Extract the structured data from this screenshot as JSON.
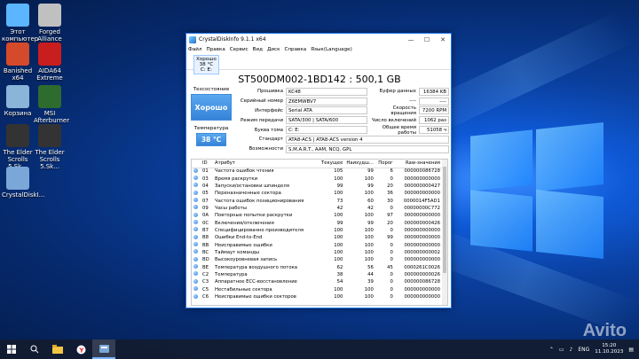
{
  "desktop": {
    "icons": [
      {
        "label": "Этот компьютер",
        "icon": "computer-icon",
        "color": "#5bb5ff"
      },
      {
        "label": "Forged Alliance",
        "icon": "forged-alliance-icon",
        "color": "#c0c0c0"
      },
      {
        "label": "Banished x64",
        "icon": "banished-icon",
        "color": "#d44a2a"
      },
      {
        "label": "AIDA64 Extreme",
        "icon": "aida64-icon",
        "color": "#c81e1e"
      },
      {
        "label": "Корзина",
        "icon": "recycle-bin-icon",
        "color": "#8ab4d8"
      },
      {
        "label": "MSI Afterburner",
        "icon": "msi-afterburner-icon",
        "color": "#2e6b2e"
      },
      {
        "label": "The Elder Scrolls 5.Sk...",
        "icon": "skyrim-icon",
        "color": "#333"
      },
      {
        "label": "The Elder Scrolls 5.Sk...",
        "icon": "skyrim-icon",
        "color": "#333"
      },
      {
        "label": "CrystalDiskI...",
        "icon": "crystaldiskinfo-icon",
        "color": "#7aa7d8"
      }
    ]
  },
  "window": {
    "title": "CrystalDiskInfo 9.1.1 x64",
    "controls": [
      "—",
      "☐",
      "✕"
    ],
    "menu": [
      "Файл",
      "Правка",
      "Сервис",
      "Вид",
      "Диск",
      "Справка",
      "Язык(Language)"
    ],
    "drive_tab": {
      "status": "Хорошо",
      "temp": "38 °C",
      "letter": "C: E:"
    }
  },
  "disk": {
    "model": "ST500DM002-1BD142 : 500,1 GB",
    "tech_status_label": "Техсостояние",
    "tech_status": "Хорошо",
    "temp_label": "Температура",
    "temp": "38 °C",
    "firmware_label": "Прошивка",
    "firmware": "KC48",
    "serial_label": "Серийный номер",
    "serial": "Z6EMWBV7",
    "interface_label": "Интерфейс",
    "interface": "Serial ATA",
    "transfer_label": "Режим передачи",
    "transfer": "SATA/300 | SATA/600",
    "letter_label": "Буква тома",
    "letter": "C: E:",
    "standard_label": "Стандарт",
    "standard": "ATA8-ACS | ATA8-ACS version 4",
    "features_label": "Возможности",
    "features": "S.M.A.R.T., AAM, NCQ, GPL",
    "buffer_label": "Буфер данных",
    "buffer": "16384 KB",
    "blank1": "----",
    "blank2": "----",
    "rpm_label": "Скорость вращения",
    "rpm": "7200 RPM",
    "power_count_label": "Число включений",
    "power_count": "1062 раз",
    "power_hours_label": "Общее время работы",
    "power_hours": "51058 ч"
  },
  "smart": {
    "headers": [
      "ID",
      "Атрибут",
      "Текущее",
      "Наихудш...",
      "Порог",
      "Raw-значения"
    ],
    "rows": [
      [
        "01",
        "Частота ошибок чтения",
        "105",
        "99",
        "6",
        "000000086728"
      ],
      [
        "03",
        "Время раскрутки",
        "100",
        "100",
        "0",
        "000000000000"
      ],
      [
        "04",
        "Запуски/остановки шпинделя",
        "99",
        "99",
        "20",
        "000000000427"
      ],
      [
        "05",
        "Переназначенные сектора",
        "100",
        "100",
        "36",
        "000000000000"
      ],
      [
        "07",
        "Частота ошибок позиционирования",
        "73",
        "60",
        "30",
        "0000014F5AD1"
      ],
      [
        "09",
        "Часы работы",
        "42",
        "42",
        "0",
        "00000000C772"
      ],
      [
        "0A",
        "Повторные попытки раскрутки",
        "100",
        "100",
        "97",
        "000000000000"
      ],
      [
        "0C",
        "Включения/отключения",
        "99",
        "99",
        "20",
        "000000000426"
      ],
      [
        "B7",
        "Специфицированно производителя",
        "100",
        "100",
        "0",
        "000000000000"
      ],
      [
        "B8",
        "Ошибки End-to-End",
        "100",
        "100",
        "99",
        "000000000000"
      ],
      [
        "BB",
        "Неисправимые ошибки",
        "100",
        "100",
        "0",
        "000000000000"
      ],
      [
        "BC",
        "Таймаут команды",
        "100",
        "100",
        "0",
        "000000000002"
      ],
      [
        "BD",
        "Высокоуровневая запись",
        "100",
        "100",
        "0",
        "000000000000"
      ],
      [
        "BE",
        "Температура воздушного потока",
        "62",
        "56",
        "45",
        "0000261C0026"
      ],
      [
        "C2",
        "Температура",
        "38",
        "44",
        "0",
        "000000000026"
      ],
      [
        "C3",
        "Аппаратное ECC-восстановление",
        "54",
        "39",
        "0",
        "000000086728"
      ],
      [
        "C5",
        "Нестабильные сектора",
        "100",
        "100",
        "0",
        "000000000000"
      ],
      [
        "C6",
        "Неисправимые ошибки секторов",
        "100",
        "100",
        "0",
        "000000000000"
      ]
    ]
  },
  "taskbar": {
    "lang": "ENG",
    "time": "15:20",
    "date": "11.10.2023"
  },
  "watermark": "Avito"
}
